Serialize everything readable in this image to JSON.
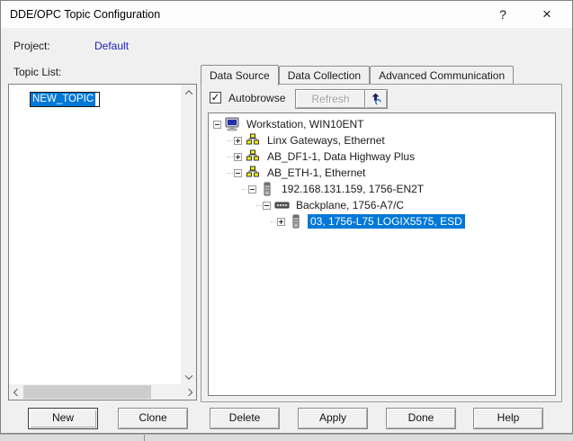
{
  "window": {
    "title": "DDE/OPC Topic Configuration",
    "help_button": "?",
    "close_button": "×"
  },
  "project": {
    "label": "Project:",
    "value": "Default"
  },
  "topic_list": {
    "label": "Topic List:",
    "items": [
      {
        "name": "NEW_TOPIC",
        "selected": true
      }
    ]
  },
  "tabs": [
    {
      "label": "Data Source",
      "active": true
    },
    {
      "label": "Data Collection",
      "active": false
    },
    {
      "label": "Advanced Communication",
      "active": false
    }
  ],
  "data_source": {
    "autobrowse_label": "Autobrowse",
    "autobrowse_checked": true,
    "checkmark": "✓",
    "refresh_label": "Refresh",
    "refresh_enabled": false,
    "tree": [
      {
        "label": "Workstation, WIN10ENT",
        "level": 0,
        "expand": "minus",
        "icon": "workstation",
        "selected": false
      },
      {
        "label": "Linx Gateways, Ethernet",
        "level": 1,
        "expand": "plus",
        "icon": "network",
        "selected": false
      },
      {
        "label": "AB_DF1-1, Data Highway Plus",
        "level": 1,
        "expand": "plus",
        "icon": "network",
        "selected": false
      },
      {
        "label": "AB_ETH-1, Ethernet",
        "level": 1,
        "expand": "minus",
        "icon": "network",
        "selected": false
      },
      {
        "label": "192.168.131.159, 1756-EN2T",
        "level": 2,
        "expand": "minus",
        "icon": "module",
        "selected": false
      },
      {
        "label": "Backplane, 1756-A7/C",
        "level": 3,
        "expand": "minus",
        "icon": "backplane",
        "selected": false
      },
      {
        "label": "03, 1756-L75 LOGIX5575, ESD",
        "level": 4,
        "expand": "plus",
        "icon": "module",
        "selected": true
      }
    ]
  },
  "buttons": [
    {
      "label": "New",
      "default": true
    },
    {
      "label": "Clone",
      "default": false
    },
    {
      "label": "Delete",
      "default": false
    },
    {
      "label": "Apply",
      "default": false
    },
    {
      "label": "Done",
      "default": false
    },
    {
      "label": "Help",
      "default": false
    }
  ],
  "colors": {
    "selection": "#0078d7",
    "project_value_blue": "#2121bb",
    "titlebar_bg": "#fdfdfd",
    "dialog_bg": "#f0f0f0"
  }
}
